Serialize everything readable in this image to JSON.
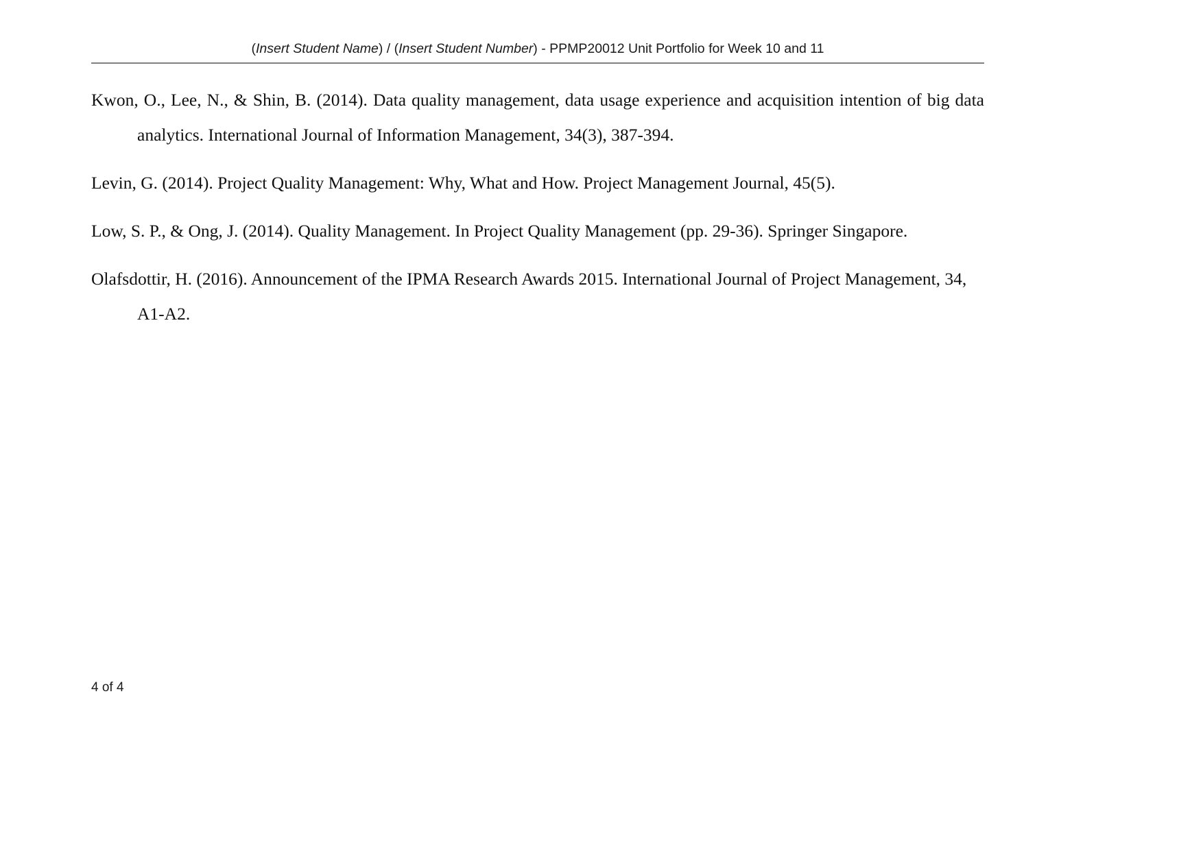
{
  "header": {
    "prefix_paren_open": "(",
    "student_name_placeholder": "Insert Student Name",
    "middle": ") / (",
    "student_number_placeholder": "Insert Student Number",
    "suffix": ") - PPMP20012 Unit Portfolio for Week 10 and 11",
    "rule_color": "#808080"
  },
  "references": [
    {
      "id": "ref-kwon-2014",
      "text": "Kwon, O., Lee, N., & Shin, B. (2014). Data quality management, data usage experience and acquisition intention of big data analytics. International Journal of Information Management, 34(3), 387-394.",
      "lines": 2
    },
    {
      "id": "ref-levin-2014",
      "text": "Levin, G. (2014). Project Quality Management: Why, What and How. Project Management Journal, 45(5).",
      "lines": 1
    },
    {
      "id": "ref-low-ong-2014",
      "text": "Low, S. P., & Ong, J. (2014). Quality Management. In Project Quality Management (pp. 29-36). Springer Singapore.",
      "lines": 1
    },
    {
      "id": "ref-olafsdottir-2016",
      "text": "Olafsdottir, H. (2016). Announcement of the IPMA Research Awards 2015. International Journal of Project Management, 34, A1-A2.",
      "lines": 1
    }
  ],
  "footer": {
    "page_label": "4 of 4",
    "current_page": 4,
    "total_pages": 4
  },
  "colors": {
    "text": "#111111",
    "header_text": "#1a1a1a",
    "rule": "#808080",
    "page_background": "#ffffff"
  }
}
